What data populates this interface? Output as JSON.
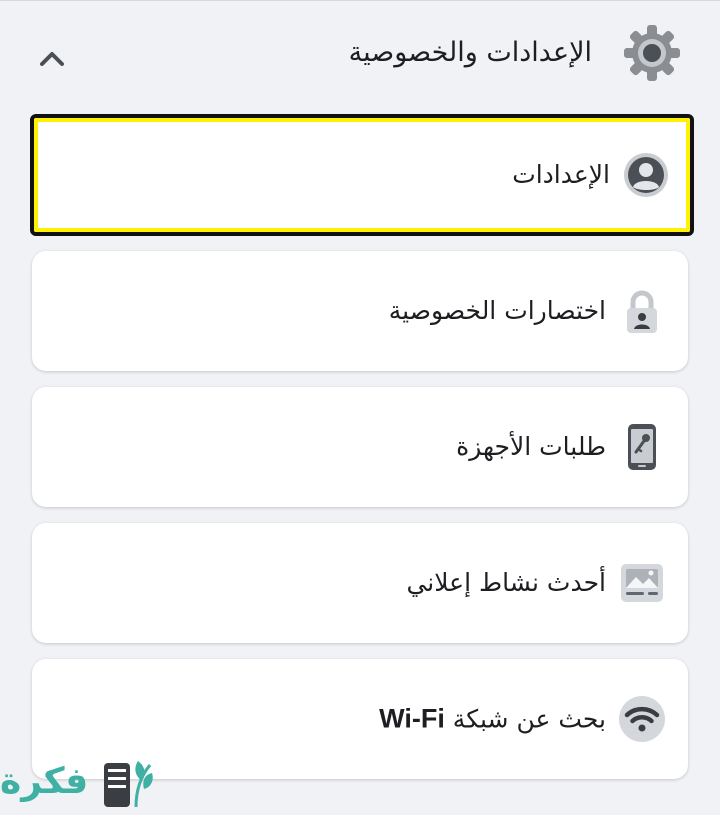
{
  "header": {
    "title": "الإعدادات والخصوصية",
    "gear_icon": "gear-icon",
    "collapse_icon": "chevron-up-icon"
  },
  "menu": {
    "items": [
      {
        "label": "الإعدادات",
        "icon": "profile-icon",
        "selected": true
      },
      {
        "label": "اختصارات الخصوصية",
        "icon": "lock-icon",
        "selected": false
      },
      {
        "label": "طلبات الأجهزة",
        "icon": "phone-key-icon",
        "selected": false
      },
      {
        "label": "أحدث نشاط إعلاني",
        "icon": "ad-image-icon",
        "selected": false
      },
      {
        "label_prefix": "بحث عن شبكة ",
        "label_bold": "Wi-Fi",
        "icon": "wifi-icon",
        "selected": false
      }
    ]
  },
  "watermark": {
    "text": "فكرة",
    "icon": "watermark-logo"
  },
  "colors": {
    "background": "#f0f2f5",
    "card": "#ffffff",
    "text": "#1c1e21",
    "icon_gray": "#8a8d91",
    "selection_outline": "#fff200",
    "watermark": "#3fb0a4"
  }
}
